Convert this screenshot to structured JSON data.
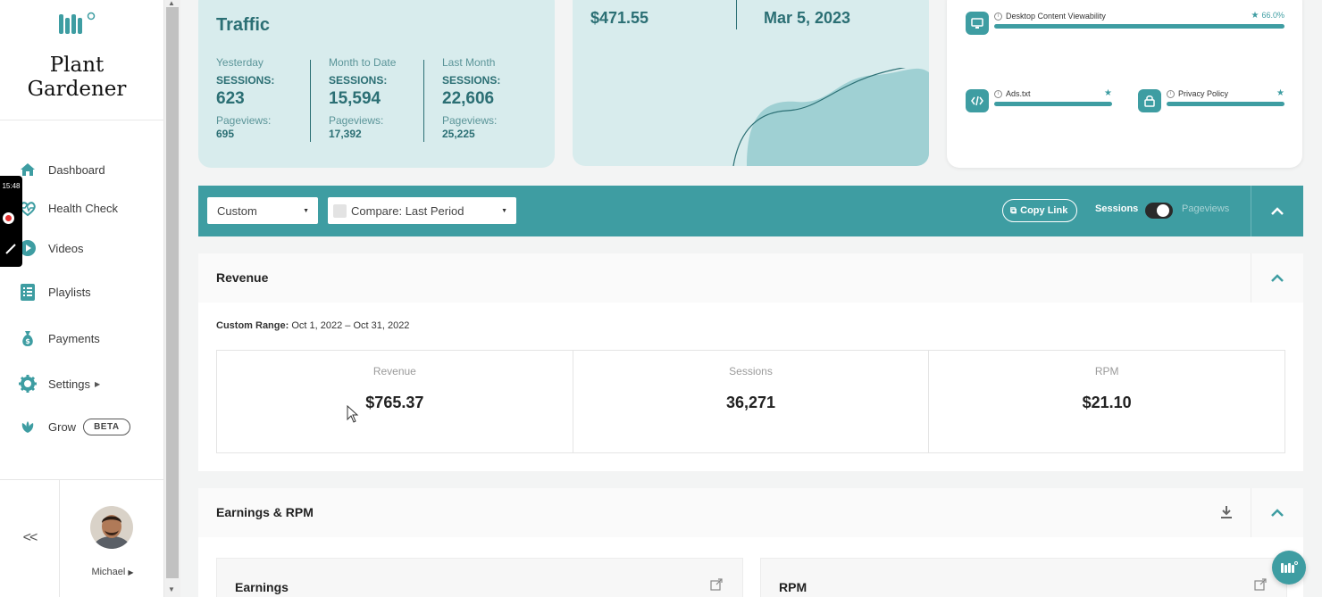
{
  "brand": {
    "name": "Plant Gardener"
  },
  "sidebar": {
    "items": [
      {
        "label": "Dashboard",
        "icon": "home-icon"
      },
      {
        "label": "Health Check",
        "icon": "heartbeat-icon"
      },
      {
        "label": "Videos",
        "icon": "play-icon"
      },
      {
        "label": "Playlists",
        "icon": "list-icon"
      },
      {
        "label": "Payments",
        "icon": "money-bag-icon"
      },
      {
        "label": "Settings",
        "icon": "gear-icon"
      },
      {
        "label": "Grow",
        "icon": "leaf-icon",
        "badge": "BETA"
      }
    ],
    "collapse_label": "<<",
    "user_name": "Michael"
  },
  "recorder": {
    "time": "15:48"
  },
  "traffic": {
    "title": "Traffic",
    "columns": [
      {
        "label": "Yesterday",
        "sessions_label": "SESSIONS:",
        "sessions": "623",
        "pageviews_label": "Pageviews:",
        "pageviews": "695"
      },
      {
        "label": "Month to Date",
        "sessions_label": "SESSIONS:",
        "sessions": "15,594",
        "pageviews_label": "Pageviews:",
        "pageviews": "17,392"
      },
      {
        "label": "Last Month",
        "sessions_label": "SESSIONS:",
        "sessions": "22,606",
        "pageviews_label": "Pageviews:",
        "pageviews": "25,225"
      }
    ]
  },
  "revenue_card": {
    "amount": "$471.55",
    "date": "Mar 5, 2023"
  },
  "health": {
    "items": [
      {
        "title": "Desktop Content Viewability",
        "percent": "66.0%"
      },
      {
        "title": "Ads.txt"
      },
      {
        "title": "Privacy Policy"
      }
    ]
  },
  "filters": {
    "range_select": "Custom",
    "compare_select": "Compare: Last Period",
    "copy_link": "Copy Link",
    "toggle_left": "Sessions",
    "toggle_right": "Pageviews"
  },
  "revenue_section": {
    "title": "Revenue",
    "range_label": "Custom Range:",
    "range_value": "Oct 1, 2022 – Oct 31, 2022",
    "metrics": [
      {
        "label": "Revenue",
        "value": "$765.37"
      },
      {
        "label": "Sessions",
        "value": "36,271"
      },
      {
        "label": "RPM",
        "value": "$21.10"
      }
    ]
  },
  "earnings_section": {
    "title": "Earnings & RPM",
    "cards": [
      {
        "title": "Earnings"
      },
      {
        "title": "RPM"
      }
    ]
  },
  "colors": {
    "accent": "#3e9da2",
    "card_bg": "#d8eced",
    "text_teal": "#2b6f74"
  }
}
